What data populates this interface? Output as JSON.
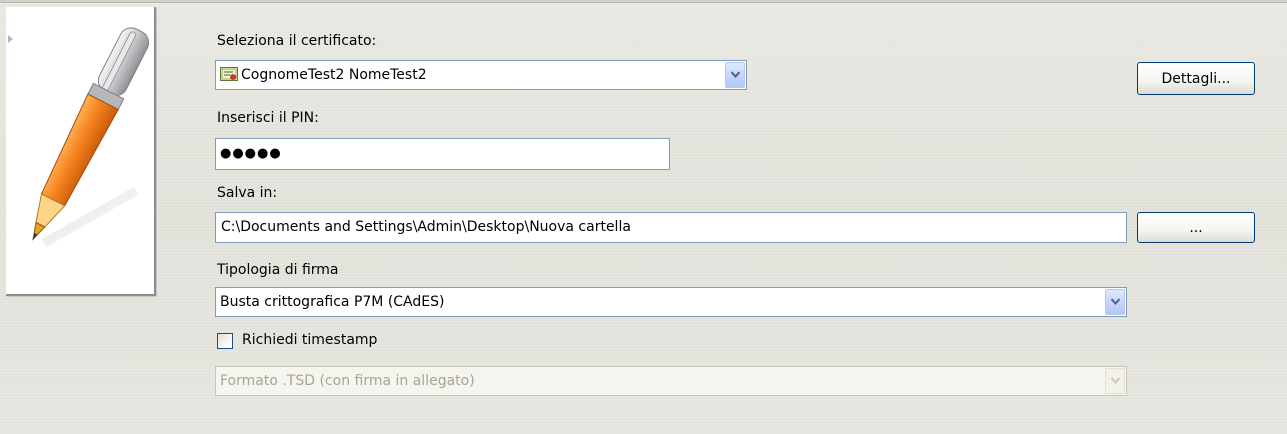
{
  "certificate": {
    "label": "Seleziona il certificato:",
    "selected": "CognomeTest2 NomeTest2",
    "details_button": "Dettagli..."
  },
  "pin": {
    "label": "Inserisci il PIN:",
    "masked_value": "●●●●●"
  },
  "save": {
    "label": "Salva in:",
    "path": "C:\\Documents and Settings\\Admin\\Desktop\\Nuova cartella",
    "browse_button": "..."
  },
  "signature_type": {
    "label": "Tipologia di firma",
    "selected": "Busta crittografica P7M (CAdES)"
  },
  "timestamp": {
    "checkbox_label": "Richiedi timestamp",
    "checked": false,
    "format_selected": "Formato .TSD (con firma in allegato)"
  },
  "colors": {
    "pen_orange": "#f07a1a",
    "xp_border": "#7f9db9",
    "button_border": "#003c74"
  }
}
